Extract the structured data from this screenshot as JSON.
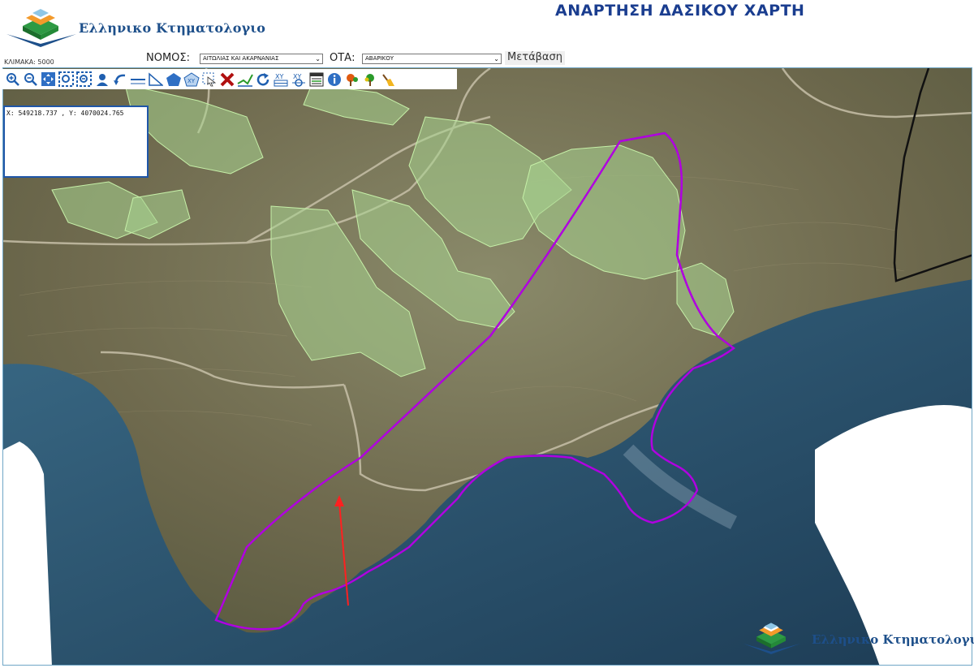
{
  "header": {
    "logo_text": "Ελληνικο Κτηματολογιο",
    "page_title": "ΑΝΑΡΤΗΣΗ ΔΑΣΙΚΟΥ ΧΑΡΤΗ"
  },
  "controls": {
    "scale_label": "ΚΛΙΜΑΚΑ: 5000",
    "nomos_label": "ΝΟΜΟΣ:",
    "nomos_value": "ΑΙΤΩΛΙΑΣ ΚΑΙ ΑΚΑΡΝΑΝΙΑΣ",
    "ota_label": "ΟΤΑ:",
    "ota_value": "ΑΒΑΡΙΚΟΥ",
    "go_label": "Μετάβαση"
  },
  "coordinates": {
    "text": "X: 549218.737 , Y: 4070024.765"
  },
  "watermark": {
    "text": "Ελληνικο Κτηματολογιο"
  },
  "toolbar": {
    "tools": [
      "zoom-in-icon",
      "zoom-out-icon",
      "pan-icon",
      "zoom-box-icon",
      "zoom-extent-icon",
      "user-icon",
      "back-icon",
      "measure-line-icon",
      "measure-angle-icon",
      "polygon-icon",
      "xy-point-icon",
      "select-icon",
      "delete-icon",
      "digitize-icon",
      "refresh-icon",
      "xy-list-icon",
      "xy-goto-icon",
      "table-icon",
      "info-icon",
      "tree-red-icon",
      "tree-green-icon",
      "eraser-icon"
    ]
  },
  "colors": {
    "forest_fill": "#a8d490",
    "boundary": "#b000e0",
    "arrow": "#ff2020",
    "sea": "#2a4d66",
    "title": "#1a3d8f"
  }
}
